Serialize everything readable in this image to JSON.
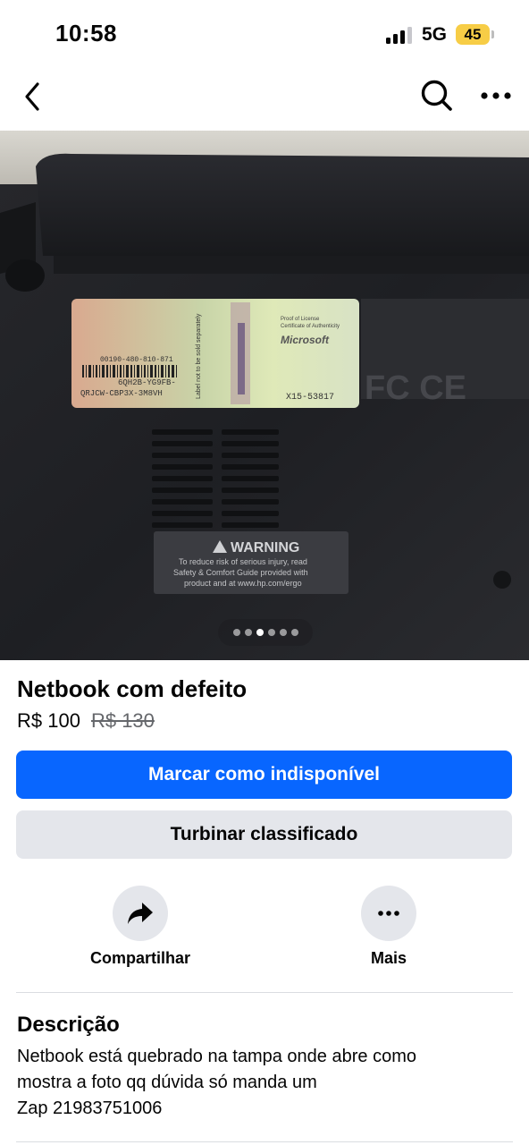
{
  "status_bar": {
    "time": "10:58",
    "network": "5G",
    "battery_level": "45",
    "battery_color": "#f7cd46"
  },
  "nav": {
    "back_icon": "chevron-left-icon",
    "search_icon": "search-icon",
    "more_icon": "more-horizontal-icon"
  },
  "photo": {
    "label_code_1": "00190-480-810-871",
    "label_key": "6QH2B-YG9FB-",
    "label_key_2": "QRJCW-CBP3X-3M8VH",
    "label_side": "Label not to be sold separately",
    "label_brand": "Microsoft",
    "label_proof": "Proof of License",
    "label_coa": "Certificate of Authenticity",
    "label_serial": "X15-53817",
    "cert_marks": "FC CE",
    "warning_title": "WARNING",
    "warning_line_1": "To reduce risk of serious injury, read",
    "warning_line_2": "Safety & Comfort Guide provided with",
    "warning_line_3": "product and at www.hp.com/ergo",
    "pager": {
      "count": 6,
      "active_index": 2
    }
  },
  "listing": {
    "title": "Netbook com defeito",
    "price": "R$ 100",
    "original_price": "R$ 130"
  },
  "buttons": {
    "primary_label": "Marcar como indisponível",
    "primary_color": "#0866ff",
    "secondary_label": "Turbinar classificado"
  },
  "actions": {
    "share_label": "Compartilhar",
    "share_icon": "share-arrow-icon",
    "more_label": "Mais",
    "more_icon": "more-horizontal-icon"
  },
  "description": {
    "heading": "Descrição",
    "text": "Netbook está quebrado na tampa onde abre como\nmostra a foto qq dúvida só manda um\nZap 21983751006"
  }
}
